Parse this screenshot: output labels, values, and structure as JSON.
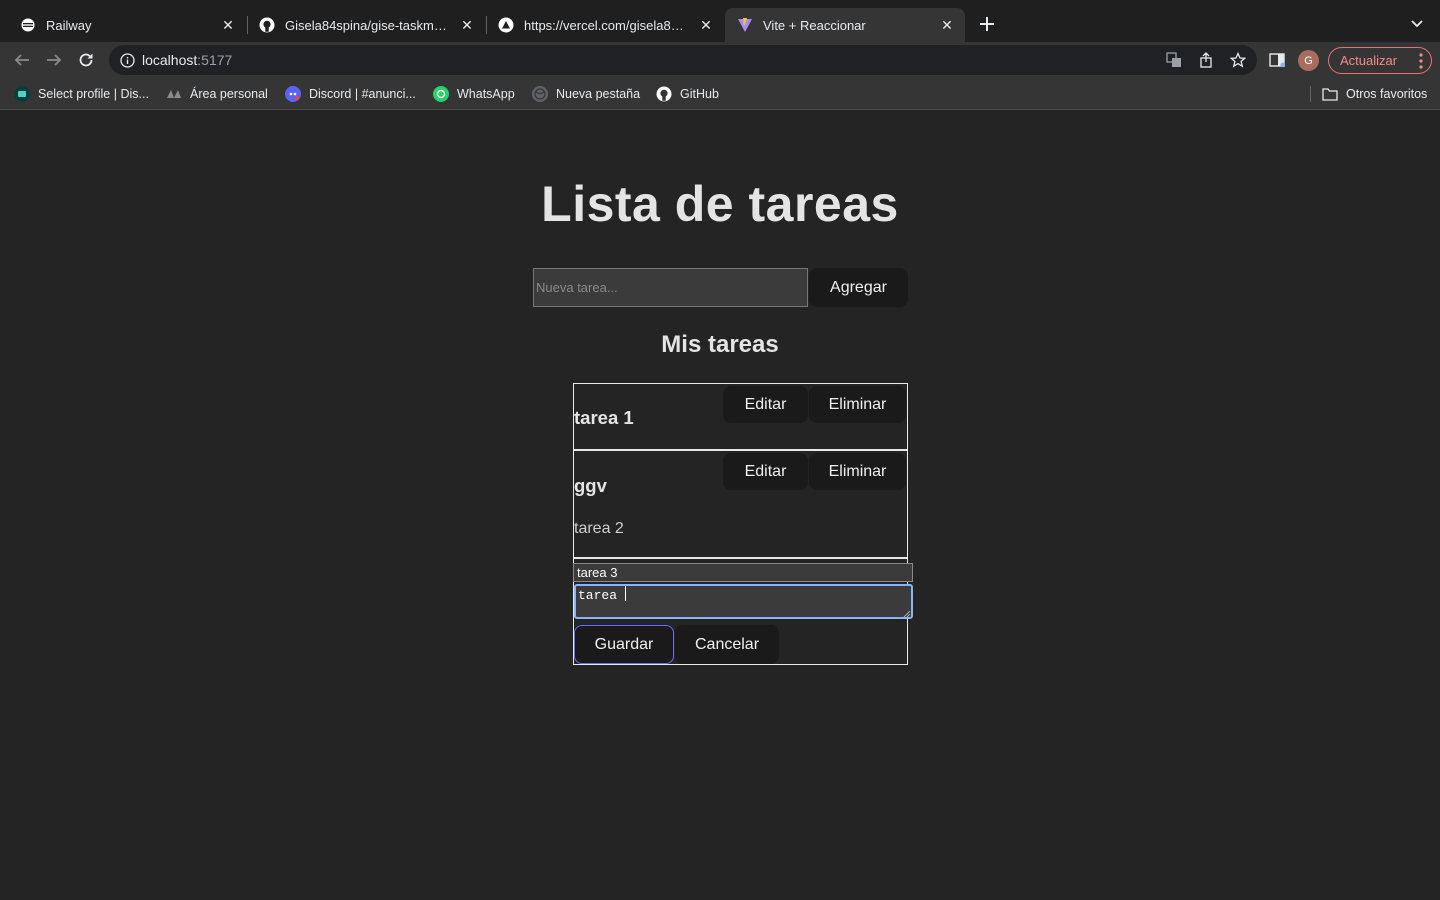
{
  "browser": {
    "tabs": [
      {
        "title": "Railway"
      },
      {
        "title": "Gisela84spina/gise-taskmaster"
      },
      {
        "title": "https://vercel.com/gisela84spina"
      },
      {
        "title": "Vite + Reaccionar"
      }
    ],
    "url_host": "localhost",
    "url_port": ":5177",
    "profile_initial": "G",
    "update_label": "Actualizar",
    "bookmarks": [
      {
        "label": "Select profile | Dis..."
      },
      {
        "label": "Área personal"
      },
      {
        "label": "Discord | #anunci..."
      },
      {
        "label": "WhatsApp"
      },
      {
        "label": "Nueva pestaña"
      },
      {
        "label": "GitHub"
      }
    ],
    "other_bookmarks": "Otros favoritos"
  },
  "app": {
    "title": "Lista de tareas",
    "new_task_placeholder": "Nueva tarea...",
    "add_label": "Agregar",
    "list_heading": "Mis tareas",
    "tasks": [
      {
        "title": "tarea 1",
        "description": "",
        "edit_label": "Editar",
        "delete_label": "Eliminar"
      },
      {
        "title": "ggv",
        "description": "tarea 2",
        "edit_label": "Editar",
        "delete_label": "Eliminar"
      }
    ],
    "editing": {
      "title_value": "tarea 3",
      "description_value": "tarea ",
      "save_label": "Guardar",
      "cancel_label": "Cancelar"
    }
  },
  "colors": {
    "background": "#242424",
    "button_bg": "#1a1a1a",
    "focus_border": "#646cff",
    "update_red": "#f28b82"
  }
}
